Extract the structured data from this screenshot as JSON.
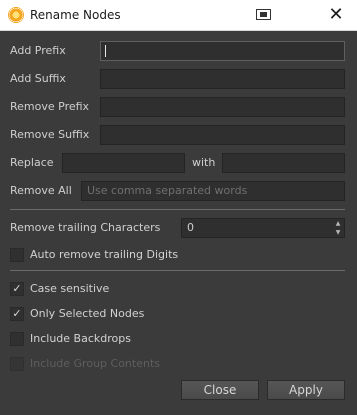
{
  "window": {
    "title": "Rename Nodes",
    "close_glyph": "✕"
  },
  "icons": {
    "app": "nuke-app-icon",
    "restore": "restore-window-icon",
    "close": "close-icon"
  },
  "fields": {
    "add_prefix": {
      "label": "Add Prefix",
      "value": ""
    },
    "add_suffix": {
      "label": "Add Suffix",
      "value": ""
    },
    "remove_prefix": {
      "label": "Remove Prefix",
      "value": ""
    },
    "remove_suffix": {
      "label": "Remove Suffix",
      "value": ""
    },
    "replace": {
      "label": "Replace",
      "value": ""
    },
    "with": {
      "label": "with",
      "value": ""
    },
    "remove_all": {
      "label": "Remove All",
      "placeholder": "Use comma separated words",
      "value": ""
    }
  },
  "trailing": {
    "label": "Remove trailing Characters",
    "value": "0",
    "auto_digits": {
      "label": "Auto remove trailing Digits",
      "checked": false
    }
  },
  "options": {
    "case_sensitive": {
      "label": "Case sensitive",
      "checked": true,
      "mark": "✓"
    },
    "only_selected": {
      "label": "Only Selected Nodes",
      "checked": true,
      "mark": "✓"
    },
    "include_backdrops": {
      "label": "Include Backdrops",
      "checked": false
    },
    "include_group": {
      "label": "Include Group Contents",
      "checked": false,
      "disabled": true
    }
  },
  "buttons": {
    "close": "Close",
    "apply": "Apply"
  },
  "spin_glyphs": {
    "up": "▲",
    "down": "▼"
  }
}
